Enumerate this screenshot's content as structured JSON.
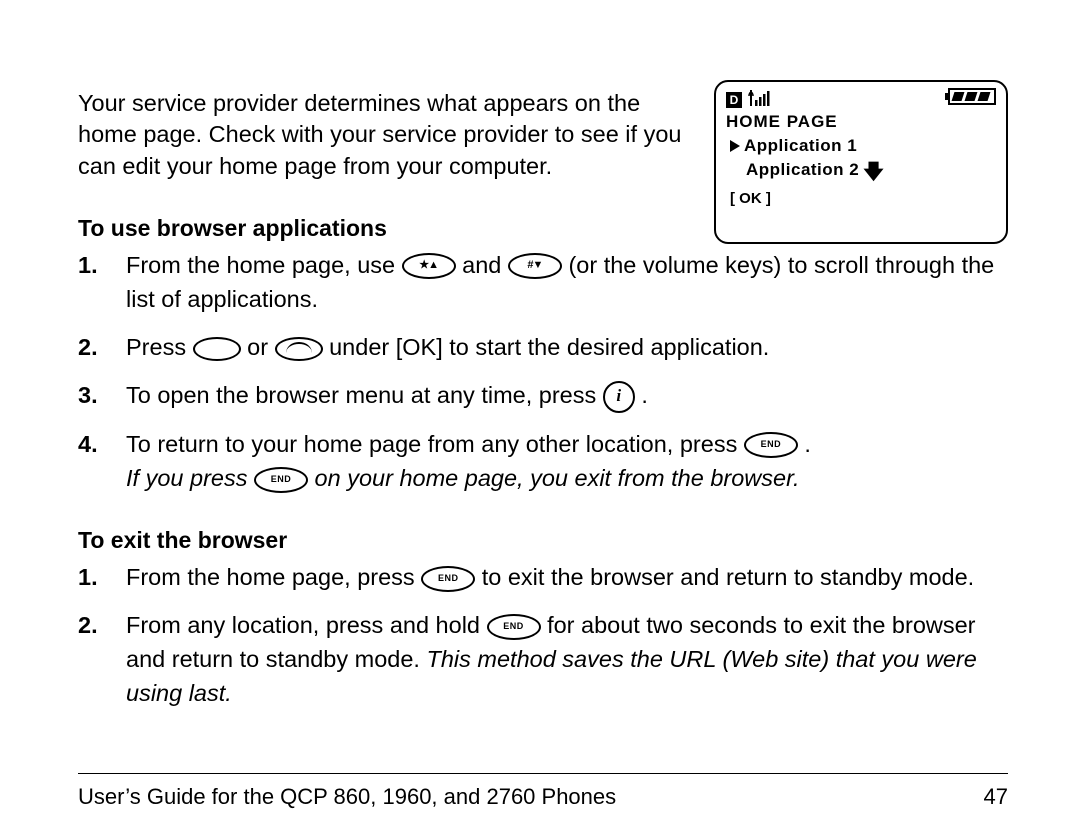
{
  "intro": "Your service provider determines what appears on the home page. Check with your service provider to see if you can edit your home page from your computer.",
  "section1": {
    "heading": "To use browser applications",
    "steps": {
      "s1a": "From the home page, use ",
      "s1b": " and ",
      "s1c": " (or the volume keys) to scroll through the list of applications.",
      "s2a": "Press ",
      "s2b": " or ",
      "s2c": " under [OK] to start the desired application.",
      "s3a": "To open the browser menu at any time, press ",
      "s3b": " .",
      "s4a": "To return to your home page from any other location, press ",
      "s4b": " .",
      "s4note_a": "If you press ",
      "s4note_b": " on your home page, you exit from the browser."
    }
  },
  "section2": {
    "heading": "To exit the browser",
    "steps": {
      "s1a": "From the home page, press ",
      "s1b": " to exit the browser and return to standby mode.",
      "s2a": "From any location, press and hold ",
      "s2b": " for about two seconds to exit the browser and return to standby mode. ",
      "s2note": "This method saves the URL (Web site) that you were using last."
    }
  },
  "phone": {
    "d": "D",
    "title": "HOME PAGE",
    "app1": "Application 1",
    "app2": "Application 2",
    "ok": "[ OK ]"
  },
  "keys": {
    "end": "END"
  },
  "footer": {
    "left": "User’s Guide for the QCP 860, 1960, and 2760 Phones",
    "right": "47"
  }
}
